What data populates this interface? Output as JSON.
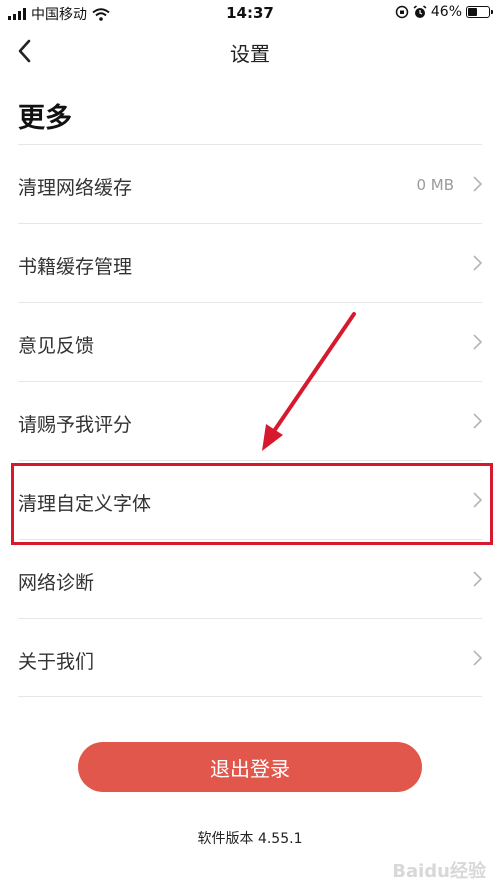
{
  "status_bar": {
    "carrier": "中国移动",
    "time": "14:37",
    "battery": "46%",
    "battery_level": 0.46
  },
  "nav": {
    "title": "设置"
  },
  "section": {
    "title": "更多"
  },
  "items": [
    {
      "label": "清理网络缓存",
      "value": "0 MB"
    },
    {
      "label": "书籍缓存管理"
    },
    {
      "label": "意见反馈"
    },
    {
      "label": "请赐予我评分"
    },
    {
      "label": "清理自定义字体"
    },
    {
      "label": "网络诊断"
    },
    {
      "label": "关于我们"
    }
  ],
  "logout_label": "退出登录",
  "version_text": "软件版本 4.55.1",
  "watermark": "Baidu经验",
  "colors": {
    "accent_button": "#e2574c",
    "annotation": "#d7192d"
  },
  "icons": [
    "signal-icon",
    "wifi-icon",
    "orientation-lock-icon",
    "alarm-icon",
    "battery-icon",
    "back-chevron-icon",
    "chevron-right-icon"
  ]
}
